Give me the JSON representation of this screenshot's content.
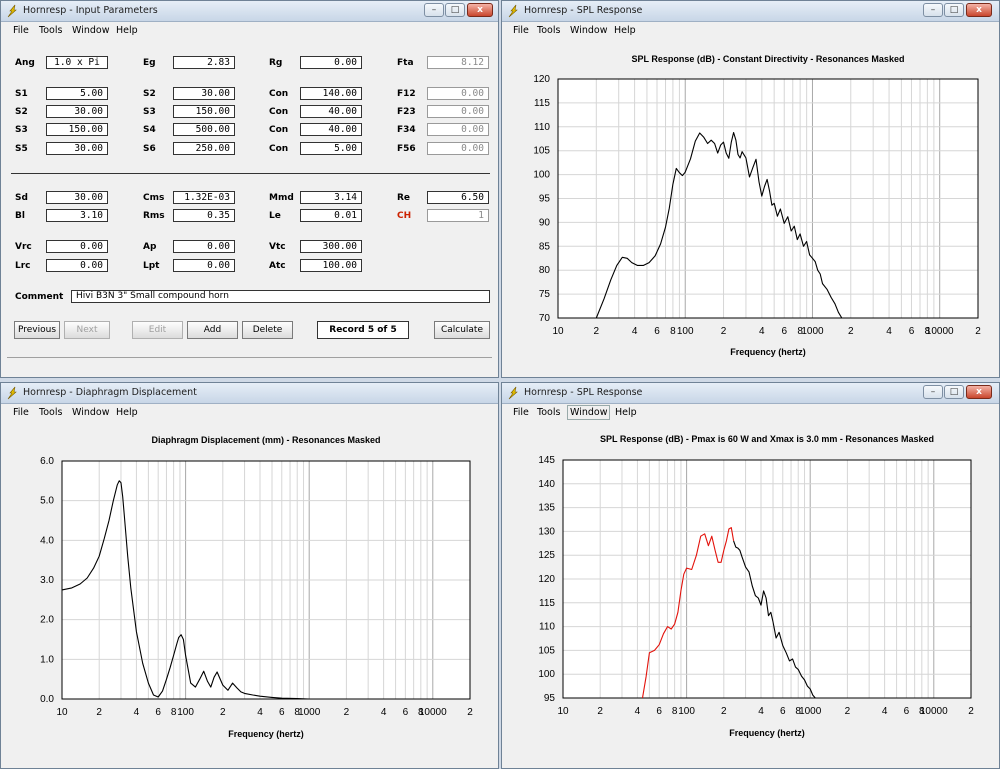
{
  "menu": [
    "File",
    "Tools",
    "Window",
    "Help"
  ],
  "window_buttons": {
    "minimize": "–",
    "maximize": "□",
    "close": "x"
  },
  "input_window": {
    "title": "Hornresp - Input Parameters",
    "fields": {
      "ang": {
        "label": "Ang",
        "value": "1.0 x Pi"
      },
      "eg": {
        "label": "Eg",
        "value": "2.83"
      },
      "rg": {
        "label": "Rg",
        "value": "0.00"
      },
      "fta": {
        "label": "Fta",
        "value": "8.12"
      },
      "s1": {
        "label": "S1",
        "value": "5.00"
      },
      "s2a": {
        "label": "S2",
        "value": "30.00"
      },
      "con1": {
        "label": "Con",
        "value": "140.00"
      },
      "f12": {
        "label": "F12",
        "value": "0.00"
      },
      "s2b": {
        "label": "S2",
        "value": "30.00"
      },
      "s3a": {
        "label": "S3",
        "value": "150.00"
      },
      "con2": {
        "label": "Con",
        "value": "40.00"
      },
      "f23": {
        "label": "F23",
        "value": "0.00"
      },
      "s3b": {
        "label": "S3",
        "value": "150.00"
      },
      "s4": {
        "label": "S4",
        "value": "500.00"
      },
      "con3": {
        "label": "Con",
        "value": "40.00"
      },
      "f34": {
        "label": "F34",
        "value": "0.00"
      },
      "s5": {
        "label": "S5",
        "value": "30.00"
      },
      "s6": {
        "label": "S6",
        "value": "250.00"
      },
      "con4": {
        "label": "Con",
        "value": "5.00"
      },
      "f56": {
        "label": "F56",
        "value": "0.00"
      },
      "sd": {
        "label": "Sd",
        "value": "30.00"
      },
      "cms": {
        "label": "Cms",
        "value": "1.32E-03"
      },
      "mmd": {
        "label": "Mmd",
        "value": "3.14"
      },
      "re": {
        "label": "Re",
        "value": "6.50"
      },
      "bl": {
        "label": "Bl",
        "value": "3.10"
      },
      "rms": {
        "label": "Rms",
        "value": "0.35"
      },
      "le": {
        "label": "Le",
        "value": "0.01"
      },
      "ch": {
        "label": "CH",
        "value": "1"
      },
      "vrc": {
        "label": "Vrc",
        "value": "0.00"
      },
      "ap": {
        "label": "Ap",
        "value": "0.00"
      },
      "vtc": {
        "label": "Vtc",
        "value": "300.00"
      },
      "lrc": {
        "label": "Lrc",
        "value": "0.00"
      },
      "lpt": {
        "label": "Lpt",
        "value": "0.00"
      },
      "atc": {
        "label": "Atc",
        "value": "100.00"
      }
    },
    "comment_label": "Comment",
    "comment_value": "Hivi B3N 3\" Small compound horn",
    "buttons": {
      "previous": "Previous",
      "next": "Next",
      "edit": "Edit",
      "add": "Add",
      "delete": "Delete",
      "calculate": "Calculate"
    },
    "record": "Record 5 of 5"
  },
  "spl1_window": {
    "title": "Hornresp - SPL Response"
  },
  "disp_window": {
    "title": "Hornresp - Diaphragm Displacement"
  },
  "spl2_window": {
    "title": "Hornresp - SPL Response"
  },
  "chart_data": [
    {
      "type": "line",
      "title": "SPL Response (dB) - Constant Directivity - Resonances Masked",
      "xlabel": "Frequency (hertz)",
      "ylabel": "",
      "xscale": "log",
      "xlim": [
        10,
        20000
      ],
      "ylim": [
        70,
        120
      ],
      "yticks": [
        "70",
        "75",
        "80",
        "85",
        "90",
        "95",
        "100",
        "105",
        "110",
        "115",
        "120"
      ],
      "xticks": [
        "10",
        "2",
        "4",
        "6",
        "8",
        "100",
        "2",
        "4",
        "6",
        "8",
        "1000",
        "2",
        "4",
        "6",
        "8",
        "10000",
        "2"
      ],
      "grid": true,
      "series": [
        {
          "color": "#000000",
          "x": [
            20,
            23,
            26,
            29,
            32,
            35,
            38,
            42,
            47,
            52,
            58,
            64,
            70,
            75,
            80,
            85,
            90,
            95,
            100,
            110,
            120,
            130,
            140,
            150,
            160,
            170,
            180,
            190,
            200,
            210,
            220,
            230,
            240,
            250,
            260,
            270,
            280,
            300,
            320,
            340,
            360,
            380,
            400,
            420,
            440,
            460,
            480,
            500,
            530,
            560,
            600,
            640,
            680,
            720,
            760,
            800,
            850,
            900,
            950,
            1000,
            1050,
            1100,
            1150,
            1200,
            1300,
            1400,
            1500,
            1600,
            1700
          ],
          "y": [
            70,
            74,
            78,
            81,
            82.7,
            82.5,
            81.6,
            81,
            81,
            81.6,
            83,
            85.5,
            89,
            93,
            98,
            101.3,
            100.4,
            99.8,
            100.5,
            103.3,
            107,
            108.7,
            107.8,
            106.5,
            107.2,
            106.5,
            104.5,
            106.2,
            106.8,
            104.5,
            103.4,
            106.8,
            108.8,
            107.2,
            104.2,
            103.5,
            104.8,
            103.5,
            99.5,
            101.5,
            103.2,
            98.5,
            95.5,
            97.5,
            99,
            96.5,
            93.6,
            94,
            91.3,
            92.8,
            89.8,
            91.2,
            88.2,
            89.2,
            86.4,
            87.6,
            85,
            86,
            83.2,
            82.5,
            81.8,
            80,
            79.2,
            77.2,
            76,
            74.3,
            73,
            71.2,
            70
          ]
        }
      ]
    },
    {
      "type": "line",
      "title": "Diaphragm Displacement (mm) - Resonances Masked",
      "xlabel": "Frequency (hertz)",
      "ylabel": "",
      "xscale": "log",
      "xlim": [
        10,
        20000
      ],
      "ylim": [
        0,
        6
      ],
      "yticks": [
        "0.0",
        "1.0",
        "2.0",
        "3.0",
        "4.0",
        "5.0",
        "6.0"
      ],
      "xticks": [
        "10",
        "2",
        "4",
        "6",
        "8",
        "100",
        "2",
        "4",
        "6",
        "8",
        "1000",
        "2",
        "4",
        "6",
        "8",
        "10000",
        "2"
      ],
      "grid": true,
      "series": [
        {
          "color": "#000000",
          "x": [
            10,
            12,
            14,
            16,
            18,
            20,
            22,
            24,
            26,
            28,
            29,
            30,
            31,
            32,
            34,
            36,
            40,
            45,
            50,
            55,
            60,
            65,
            70,
            75,
            80,
            85,
            88,
            92,
            96,
            100,
            110,
            120,
            130,
            140,
            150,
            160,
            170,
            180,
            200,
            220,
            240,
            260,
            280,
            300,
            350,
            400,
            500,
            600,
            800,
            1000
          ],
          "y": [
            2.75,
            2.8,
            2.9,
            3.05,
            3.3,
            3.6,
            4.05,
            4.5,
            5.0,
            5.4,
            5.5,
            5.45,
            5.1,
            4.6,
            3.6,
            2.8,
            1.7,
            0.9,
            0.4,
            0.1,
            0.05,
            0.2,
            0.5,
            0.8,
            1.1,
            1.4,
            1.55,
            1.62,
            1.5,
            1.1,
            0.4,
            0.3,
            0.5,
            0.7,
            0.45,
            0.3,
            0.55,
            0.68,
            0.35,
            0.22,
            0.4,
            0.28,
            0.18,
            0.14,
            0.1,
            0.07,
            0.04,
            0.02,
            0.01,
            0.0
          ]
        }
      ]
    },
    {
      "type": "line",
      "title": "SPL Response (dB) - Pmax is 60 W and Xmax is 3.0 mm - Resonances Masked",
      "xlabel": "Frequency (hertz)",
      "ylabel": "",
      "xscale": "log",
      "xlim": [
        10,
        20000
      ],
      "ylim": [
        95,
        145
      ],
      "yticks": [
        "95",
        "100",
        "105",
        "110",
        "115",
        "120",
        "125",
        "130",
        "135",
        "140",
        "145"
      ],
      "xticks": [
        "10",
        "2",
        "4",
        "6",
        "8",
        "100",
        "2",
        "4",
        "6",
        "8",
        "1000",
        "2",
        "4",
        "6",
        "8",
        "10000",
        "2"
      ],
      "grid": true,
      "series": [
        {
          "name": "",
          "color": "#e3120b",
          "x": [
            44,
            47,
            50,
            55,
            60,
            65,
            70,
            75,
            80,
            85,
            90,
            95,
            100,
            110,
            120,
            130,
            140,
            150,
            160,
            170,
            180,
            190,
            200,
            210,
            220,
            230,
            240
          ],
          "y": [
            95,
            99.5,
            104.5,
            105,
            106.2,
            108.5,
            110,
            109.5,
            110.5,
            113,
            117.5,
            121,
            122.3,
            122,
            125,
            129,
            129.5,
            127,
            129,
            126,
            123.5,
            123.5,
            126,
            128,
            130.5,
            130.8,
            128
          ]
        },
        {
          "name": "",
          "color": "#000000",
          "x": [
            240,
            250,
            260,
            270,
            280,
            300,
            320,
            340,
            360,
            380,
            400,
            420,
            440,
            460,
            480,
            500,
            530,
            560,
            600,
            640,
            680,
            720,
            760,
            800,
            850,
            900,
            950,
            1000,
            1050,
            1100
          ],
          "y": [
            128,
            126.7,
            126.5,
            126,
            124.7,
            122.5,
            121.5,
            118.5,
            116.5,
            116,
            114.5,
            117.5,
            116,
            112.3,
            113,
            111,
            107.6,
            108.8,
            106,
            104.5,
            102.8,
            103.2,
            101.5,
            101,
            99.6,
            98.8,
            97.5,
            96.9,
            95.6,
            95
          ]
        }
      ]
    }
  ]
}
